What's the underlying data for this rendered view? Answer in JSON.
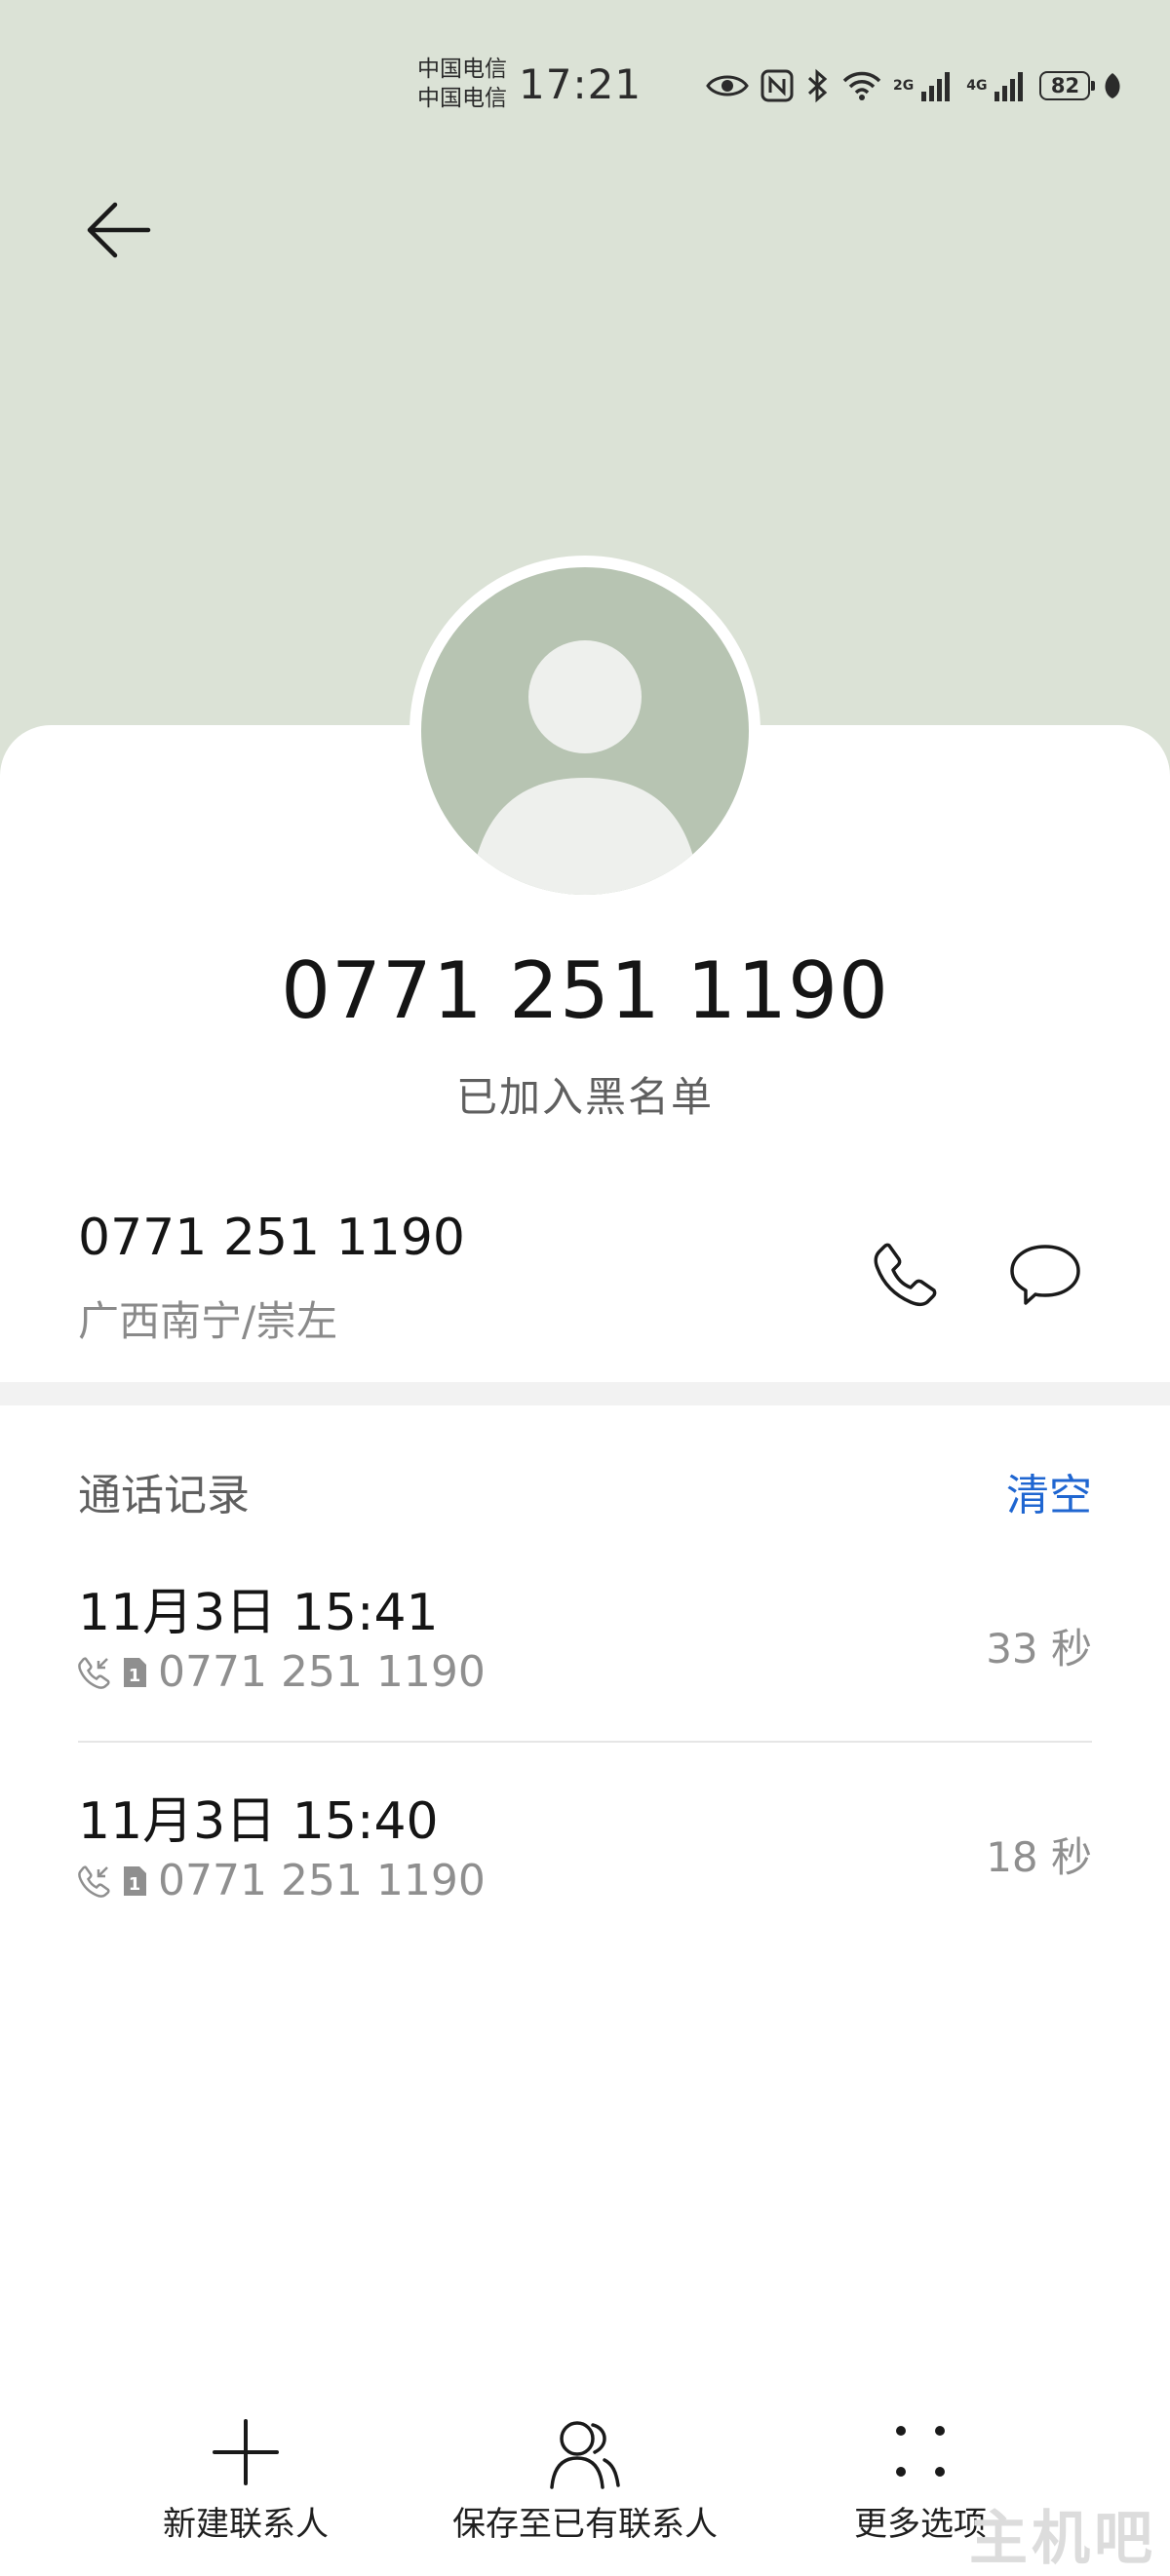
{
  "status_bar": {
    "carrier_1": "中国电信",
    "carrier_2": "中国电信",
    "time": "17:21",
    "network_1": "2G",
    "network_2": "4G",
    "battery": "82",
    "icons": [
      "eye-icon",
      "nfc-icon",
      "bluetooth-icon",
      "wifi-icon",
      "signal-icon",
      "signal-icon",
      "battery-icon",
      "leaf-icon"
    ]
  },
  "header": {
    "back_icon": "arrow-left-icon",
    "avatar_icon": "person-icon"
  },
  "contact": {
    "title": "0771 251 1190",
    "status": "已加入黑名单",
    "phone": "0771 251 1190",
    "location": "广西南宁/崇左",
    "call_icon": "phone-icon",
    "message_icon": "message-bubble-icon"
  },
  "call_log": {
    "title": "通话记录",
    "clear_label": "清空",
    "items": [
      {
        "time": "11月3日 15:41",
        "number": "0771 251 1190",
        "duration": "33 秒",
        "icon": "incoming-call-icon",
        "sim": "1"
      },
      {
        "time": "11月3日 15:40",
        "number": "0771 251 1190",
        "duration": "18 秒",
        "icon": "incoming-call-icon",
        "sim": "1"
      }
    ]
  },
  "bottom_nav": {
    "new_contact": "新建联系人",
    "save_existing": "保存至已有联系人",
    "more": "更多选项"
  },
  "watermark": "主机吧",
  "colors": {
    "header_bg": "#dbe2d6",
    "accent": "#1f66d1",
    "avatar": "#b7c4b2"
  }
}
